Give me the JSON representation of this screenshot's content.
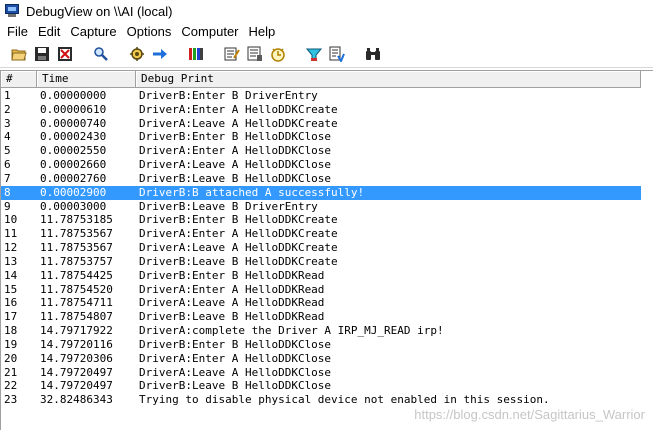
{
  "window": {
    "title": "DebugView on \\\\AI (local)"
  },
  "menu": [
    "File",
    "Edit",
    "Capture",
    "Options",
    "Computer",
    "Help"
  ],
  "toolbar": {
    "groups": [
      [
        "open-folder-icon",
        "save-icon",
        "clear-display-icon"
      ],
      [
        "find-icon"
      ],
      [
        "capture-gear-icon",
        "autoscroll-arrow-icon"
      ],
      [
        "history-depth-icon"
      ],
      [
        "highlight-icon",
        "filter-icon",
        "clock-time-icon"
      ],
      [
        "capture-kernel-icon",
        "capture-win32-icon"
      ],
      [
        "binoculars-icon"
      ]
    ]
  },
  "columns": {
    "num": "#",
    "time": "Time",
    "print": "Debug Print"
  },
  "selected_row": 8,
  "rows": [
    {
      "num": "1",
      "time": "0.00000000",
      "print": "DriverB:Enter B DriverEntry"
    },
    {
      "num": "2",
      "time": "0.00000610",
      "print": "DriverA:Enter A HelloDDKCreate"
    },
    {
      "num": "3",
      "time": "0.00000740",
      "print": "DriverA:Leave A HelloDDKCreate"
    },
    {
      "num": "4",
      "time": "0.00002430",
      "print": "DriverB:Enter B HelloDDKClose"
    },
    {
      "num": "5",
      "time": "0.00002550",
      "print": "DriverA:Enter A HelloDDKClose"
    },
    {
      "num": "6",
      "time": "0.00002660",
      "print": "DriverA:Leave A HelloDDKClose"
    },
    {
      "num": "7",
      "time": "0.00002760",
      "print": "DriverB:Leave B HelloDDKClose"
    },
    {
      "num": "8",
      "time": "0.00002900",
      "print": "DriverB:B attached A successfully!"
    },
    {
      "num": "9",
      "time": "0.00003000",
      "print": "DriverB:Leave B DriverEntry"
    },
    {
      "num": "10",
      "time": "11.78753185",
      "print": "DriverB:Enter B HelloDDKCreate"
    },
    {
      "num": "11",
      "time": "11.78753567",
      "print": "DriverA:Enter A HelloDDKCreate"
    },
    {
      "num": "12",
      "time": "11.78753567",
      "print": "DriverA:Leave A HelloDDKCreate"
    },
    {
      "num": "13",
      "time": "11.78753757",
      "print": "DriverB:Leave B HelloDDKCreate"
    },
    {
      "num": "14",
      "time": "11.78754425",
      "print": "DriverB:Enter B HelloDDKRead"
    },
    {
      "num": "15",
      "time": "11.78754520",
      "print": "DriverA:Enter A HelloDDKRead"
    },
    {
      "num": "16",
      "time": "11.78754711",
      "print": "DriverA:Leave A HelloDDKRead"
    },
    {
      "num": "17",
      "time": "11.78754807",
      "print": "DriverB:Leave B HelloDDKRead"
    },
    {
      "num": "18",
      "time": "14.79717922",
      "print": "DriverA:complete the Driver A IRP_MJ_READ irp!"
    },
    {
      "num": "19",
      "time": "14.79720116",
      "print": "DriverB:Enter B HelloDDKClose"
    },
    {
      "num": "20",
      "time": "14.79720306",
      "print": "DriverA:Enter A HelloDDKClose"
    },
    {
      "num": "21",
      "time": "14.79720497",
      "print": "DriverA:Leave A HelloDDKClose"
    },
    {
      "num": "22",
      "time": "14.79720497",
      "print": "DriverB:Leave B HelloDDKClose"
    },
    {
      "num": "23",
      "time": "32.82486343",
      "print": "Trying to disable physical device not enabled in this session."
    }
  ],
  "watermark": "https://blog.csdn.net/Sagittarius_Warrior",
  "colors": {
    "selection": "#3399ff",
    "header_bg": "#f0f0f0"
  }
}
